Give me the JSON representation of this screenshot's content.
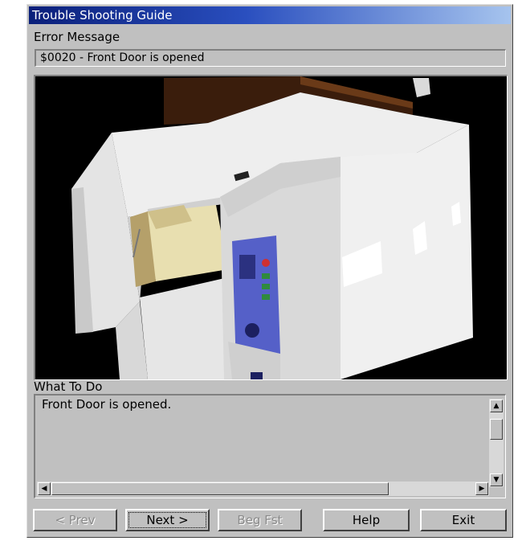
{
  "window": {
    "title": "Trouble Shooting Guide"
  },
  "error": {
    "label": "Error Message",
    "value": "$0020 - Front Door is opened"
  },
  "what_to_do": {
    "label": "What To Do",
    "text": "Front Door is opened."
  },
  "buttons": {
    "prev": "< Prev",
    "next": "Next >",
    "beginning": "Beg Fst",
    "help": "Help",
    "exit": "Exit"
  },
  "icons": {
    "scroll_up": "up-arrow-icon",
    "scroll_down": "down-arrow-icon",
    "scroll_left": "left-arrow-icon",
    "scroll_right": "right-arrow-icon"
  },
  "colors": {
    "titlebar_start": "#0a1f7a",
    "titlebar_end": "#a6c4ee",
    "dialog_face": "#c0c0c0",
    "viewport_bg": "#000000",
    "control_panel": "#5560c8"
  }
}
